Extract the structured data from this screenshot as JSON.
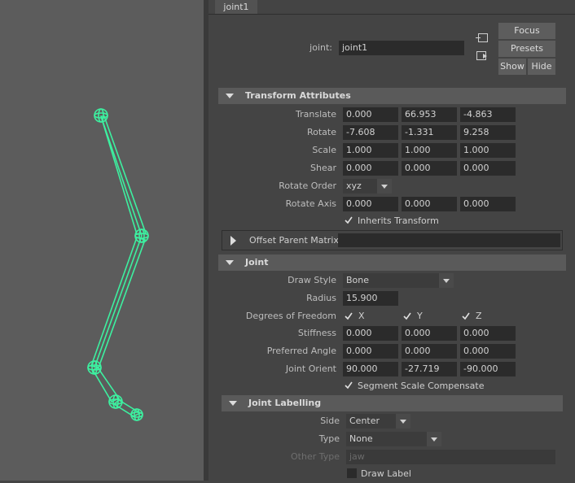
{
  "tab": {
    "label": "joint1"
  },
  "header": {
    "joint_label": "joint:",
    "joint_value": "joint1",
    "focus": "Focus",
    "presets": "Presets",
    "show": "Show",
    "hide": "Hide"
  },
  "transform": {
    "title": "Transform Attributes",
    "translate": {
      "label": "Translate",
      "x": "0.000",
      "y": "66.953",
      "z": "-4.863"
    },
    "rotate": {
      "label": "Rotate",
      "x": "-7.608",
      "y": "-1.331",
      "z": "9.258"
    },
    "scale": {
      "label": "Scale",
      "x": "1.000",
      "y": "1.000",
      "z": "1.000"
    },
    "shear": {
      "label": "Shear",
      "x": "0.000",
      "y": "0.000",
      "z": "0.000"
    },
    "rotate_order": {
      "label": "Rotate Order",
      "value": "xyz"
    },
    "rotate_axis": {
      "label": "Rotate Axis",
      "x": "0.000",
      "y": "0.000",
      "z": "0.000"
    },
    "inherits": {
      "label": "Inherits Transform",
      "checked": true
    }
  },
  "offset": {
    "title": "Offset Parent Matrix"
  },
  "joint": {
    "title": "Joint",
    "draw_style": {
      "label": "Draw Style",
      "value": "Bone"
    },
    "radius": {
      "label": "Radius",
      "value": "15.900"
    },
    "dof": {
      "label": "Degrees of Freedom",
      "x": "X",
      "y": "Y",
      "z": "Z"
    },
    "stiffness": {
      "label": "Stiffness",
      "x": "0.000",
      "y": "0.000",
      "z": "0.000"
    },
    "preferred_angle": {
      "label": "Preferred Angle",
      "x": "0.000",
      "y": "0.000",
      "z": "0.000"
    },
    "joint_orient": {
      "label": "Joint Orient",
      "x": "90.000",
      "y": "-27.719",
      "z": "-90.000"
    },
    "ssc": {
      "label": "Segment Scale Compensate",
      "checked": true
    }
  },
  "labelling": {
    "title": "Joint Labelling",
    "side": {
      "label": "Side",
      "value": "Center"
    },
    "type": {
      "label": "Type",
      "value": "None"
    },
    "other_type": {
      "label": "Other Type",
      "placeholder": "jaw"
    },
    "draw_label": {
      "label": "Draw Label",
      "checked": false
    }
  },
  "colors": {
    "joint_highlight": "#3df0a0",
    "panel_bg": "#444444",
    "viewport_bg": "#5c5c5c"
  }
}
